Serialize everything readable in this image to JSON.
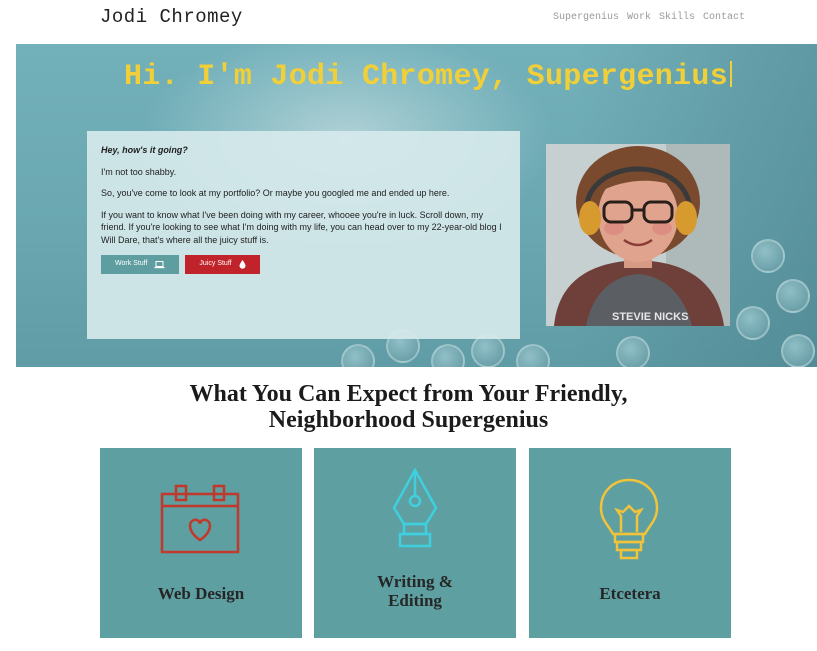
{
  "header": {
    "site_title": "Jodi Chromey",
    "nav": [
      "Supergenius",
      "Work",
      "Skills",
      "Contact"
    ]
  },
  "hero": {
    "heading": "Hi. I'm Jodi Chromey, Supergenius",
    "greeting": "Hey, how's it going?",
    "p1": "I'm not too shabby.",
    "p2": "So, you've come to look at my portfolio? Or maybe you googled me and ended up here.",
    "p3": "If you want to know what I've been doing with my career, whooee you're in luck. Scroll down, my friend. If you're looking to see what I'm doing with my life, you can head over to my 22-year-old blog I Will Dare, that's where all the juicy stuff is.",
    "buttons": {
      "work": "Work Stuff",
      "juicy": "Juicy Stuff"
    }
  },
  "section": {
    "title_line1": "What You Can Expect from Your Friendly,",
    "title_line2": "Neighborhood Supergenius",
    "cards": [
      {
        "line1": "Web Design",
        "line2": ""
      },
      {
        "line1": "Writing &",
        "line2": "Editing"
      },
      {
        "line1": "Etcetera",
        "line2": ""
      }
    ]
  },
  "colors": {
    "teal": "#5e9fa2",
    "hero_yellow": "#f1cf38",
    "juicy_red": "#c0242a",
    "icon_red": "#c0392b",
    "icon_cyan": "#3fd0df",
    "icon_yellow": "#f0c33a"
  },
  "icons": [
    "laptop-icon",
    "drop-icon",
    "calendar-heart-icon",
    "pen-nib-icon",
    "lightbulb-icon"
  ]
}
